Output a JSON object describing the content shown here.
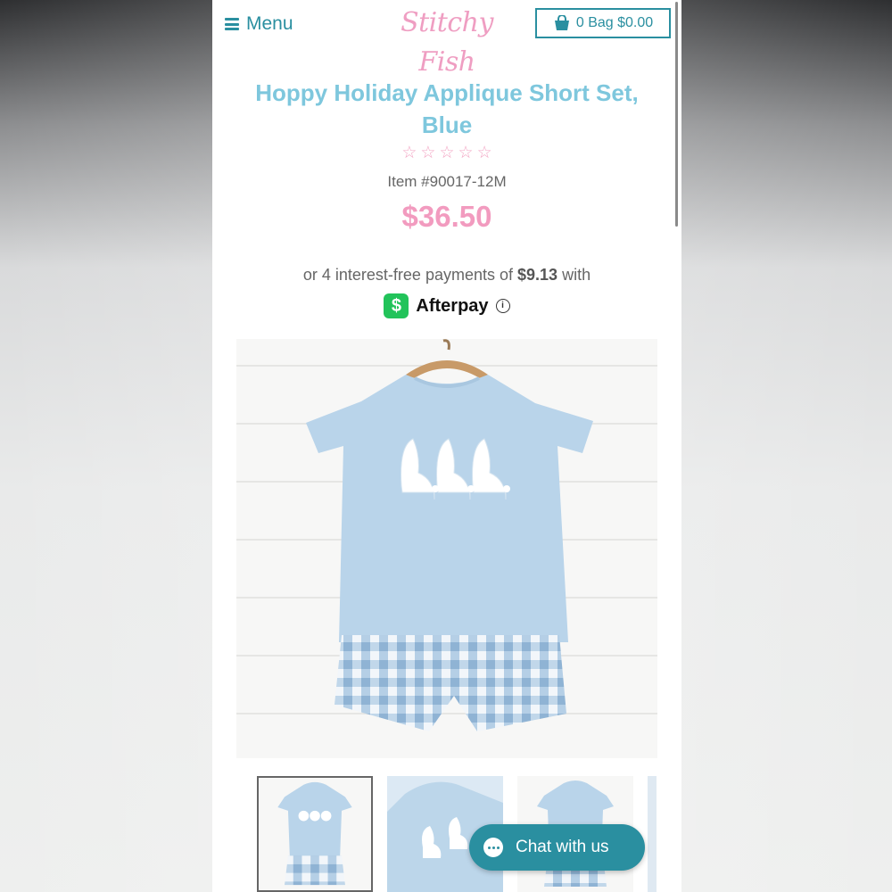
{
  "header": {
    "menu_label": "Menu",
    "logo_text": "Stitchy Fish",
    "bag_label": "0 Bag $0.00"
  },
  "product": {
    "title": "Hoppy Holiday Applique Short Set, Blue",
    "rating_stars": 0,
    "rating_max": 5,
    "item_number": "Item #90017-12M",
    "price": "$36.50",
    "afterpay_prefix": "or 4 interest-free payments of",
    "afterpay_amount": "$9.13",
    "afterpay_suffix": "with",
    "afterpay_badge": "$",
    "afterpay_brand": "Afterpay",
    "info_symbol": "i"
  },
  "chat": {
    "label": "Chat with us"
  },
  "colors": {
    "accent": "#2a8fa0",
    "title": "#7ec7dd",
    "price": "#f29bbf",
    "stars": "#f3a6c4",
    "afterpay_green": "#22c35a"
  },
  "icons": [
    "hamburger-icon",
    "shopping-bag-icon",
    "star-outline-icon",
    "afterpay-dollar-icon",
    "info-icon",
    "chat-bubble-icon"
  ]
}
